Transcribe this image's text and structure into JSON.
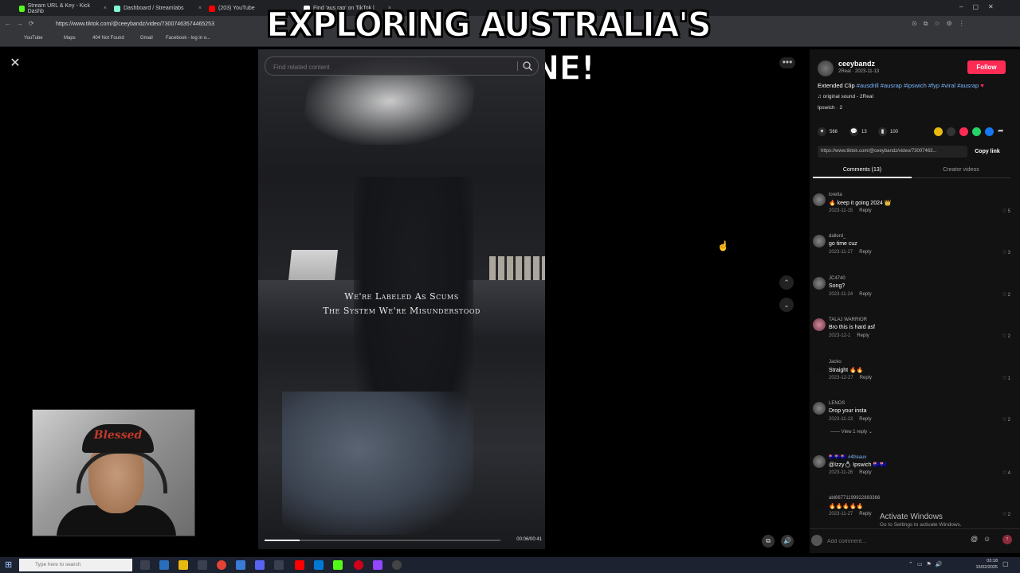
{
  "browser": {
    "tabs": [
      {
        "label": "Stream URL & Key - Kick Dashb",
        "color": "#53fc18"
      },
      {
        "label": "Dashboard / Streamlabs",
        "color": "#80f5d2"
      },
      {
        "label": "(203) YouTube",
        "color": "#ff0000"
      },
      {
        "label": "Find 'aus rap' on TikTok |",
        "color": "#ffffff"
      }
    ],
    "url": "https://www.tiktok.com/@ceeybandz/video/73007463574465253",
    "bookmarks": [
      "YouTube",
      "Maps",
      "404 Not Found",
      "Gmail",
      "Facebook - log in o..."
    ]
  },
  "overlay": {
    "banner": "EXPLORING AUSTRALIA'S RAP SCENE!"
  },
  "video": {
    "search_placeholder": "Find related content",
    "caption_line1": "We're Labeled As Scums",
    "caption_line2": "The System We're Misunderstood",
    "time": "00:06/00:41",
    "progress": 0.15
  },
  "post": {
    "username": "ceeybandz",
    "subline": "2Real · 2023-11-13",
    "follow_label": "Follow",
    "description": "Extended Clip",
    "hashtags": "#ausdrill #ausrap #ipswich #fyp #viral #ausrap",
    "sound": "♫  original sound - 2Real",
    "location": "Ipswich · 2",
    "likes": "566",
    "comments": "13",
    "saves": "100",
    "link": "https://www.tiktok.com/@ceeybandz/video/73007463...",
    "copy_label": "Copy link",
    "tab_comments": "Comments (13)",
    "tab_creator": "Creator videos"
  },
  "comments": [
    {
      "name": "loretta",
      "text": "🔥 keep it going 2024 👑",
      "date": "2023-11-15",
      "reply": "Reply",
      "likes": "5"
    },
    {
      "name": "dallerd_",
      "text": "go time cuz",
      "date": "2023-11-27",
      "reply": "Reply",
      "likes": "3"
    },
    {
      "name": "JC4740",
      "text": "Song?",
      "date": "2023-11-24",
      "reply": "Reply",
      "likes": "2"
    },
    {
      "name": "TALAJ WARRIOR",
      "text": "Bro this is hard asf",
      "date": "2023-12-1",
      "reply": "Reply",
      "likes": "2"
    },
    {
      "name": "Jacko",
      "text": "Straight 🔥🔥",
      "date": "2023-12-27",
      "reply": "Reply",
      "likes": "1"
    },
    {
      "name": "LENOS",
      "text": "Drop your insta",
      "date": "2023-11-13",
      "reply": "Reply",
      "likes": "2",
      "view_replies": "View 1 reply"
    },
    {
      "name": "🇦🇺🇦🇺🇦🇺 #4freaux",
      "text": "@Izzy💍 Ipswich 🇦🇺🇦🇺",
      "date": "2023-11-26",
      "reply": "Reply",
      "likes": "4"
    },
    {
      "name": "abl66771199922883366",
      "text": "🔥🔥🔥🔥🔥",
      "date": "2023-11-27",
      "reply": "Reply",
      "likes": "2"
    }
  ],
  "add_comment_placeholder": "Add comment...",
  "windows": {
    "activate_title": "Activate Windows",
    "activate_sub": "Go to Settings to activate Windows.",
    "search_placeholder": "Type here to search",
    "time": "03:18",
    "date": "15/02/2025"
  },
  "webcam": {
    "cap_text": "Blessed"
  }
}
